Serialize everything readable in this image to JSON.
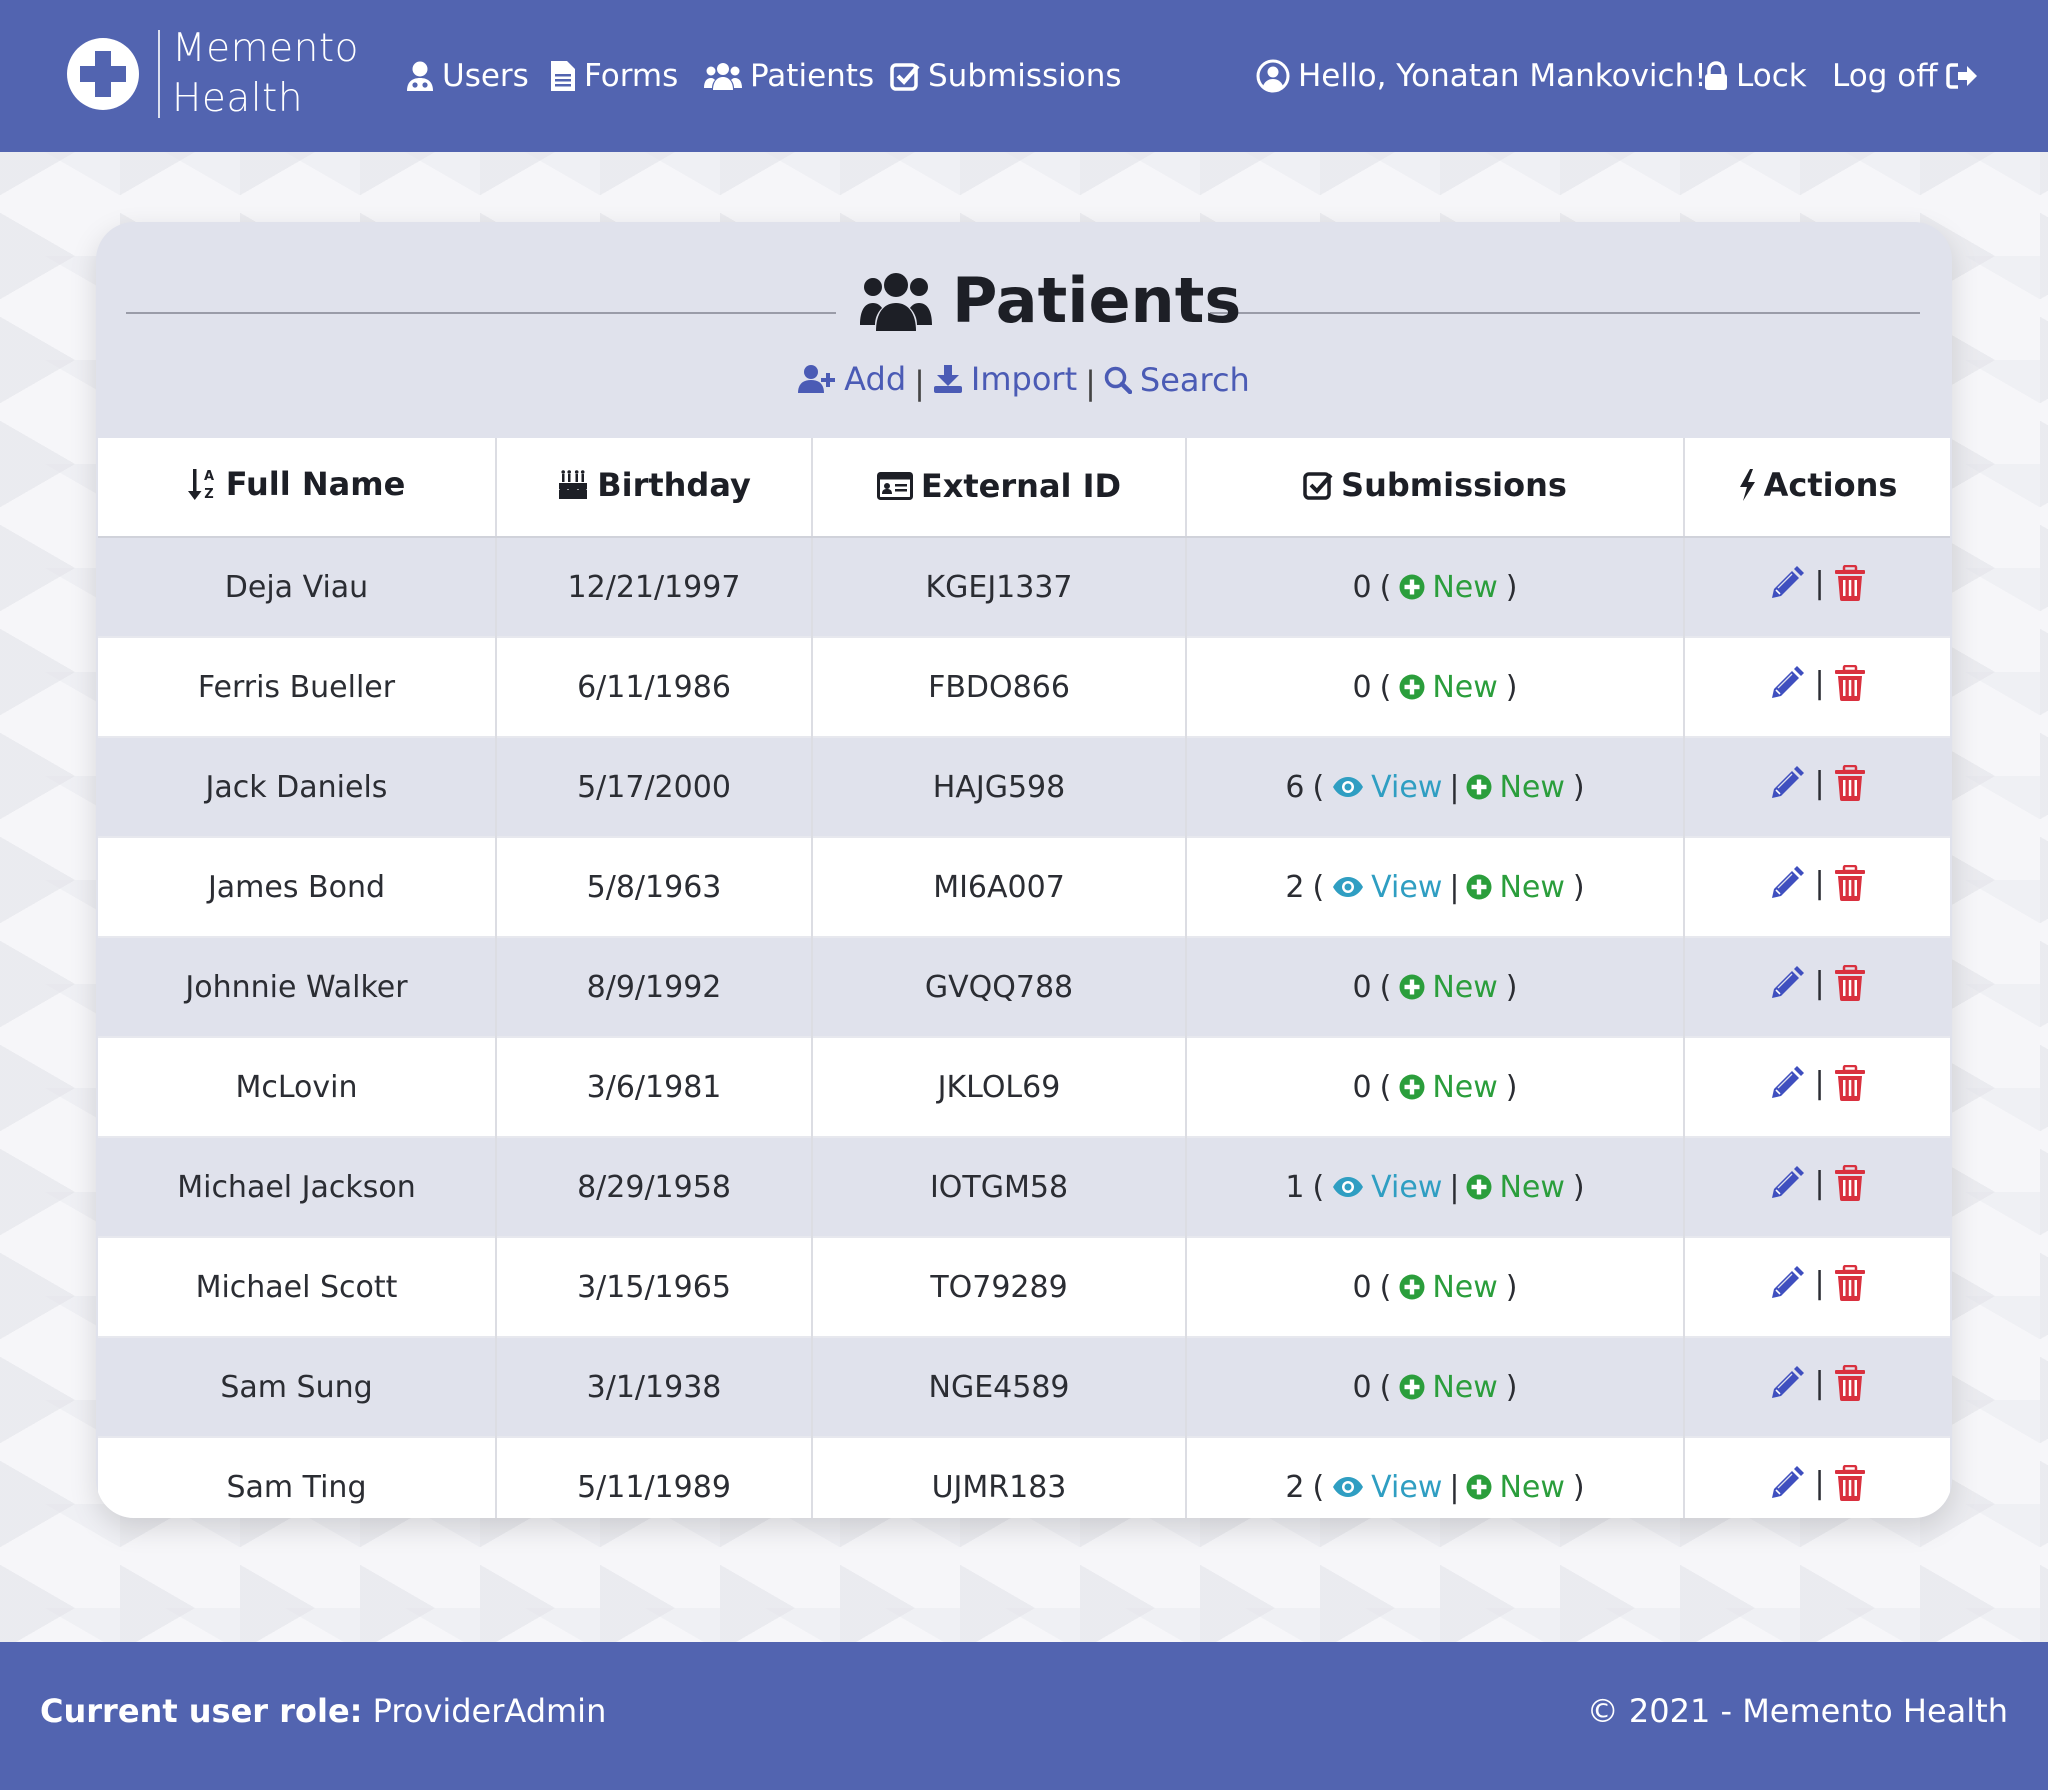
{
  "brand": {
    "line1": "Memento",
    "line2": "Health"
  },
  "nav": {
    "users": "Users",
    "forms": "Forms",
    "patients": "Patients",
    "submissions": "Submissions",
    "greeting": "Hello, Yonatan Mankovich!",
    "lock": "Lock",
    "logoff": "Log off"
  },
  "page": {
    "title": "Patients",
    "actions": {
      "add": "Add",
      "import": "Import",
      "search": "Search"
    }
  },
  "table": {
    "headers": {
      "full_name": "Full Name",
      "birthday": "Birthday",
      "external_id": "External ID",
      "submissions": "Submissions",
      "actions": "Actions"
    },
    "view_label": "View",
    "new_label": "New",
    "rows": [
      {
        "name": "Deja Viau",
        "birthday": "12/21/1997",
        "external_id": "KGEJ1337",
        "submissions": "0"
      },
      {
        "name": "Ferris Bueller",
        "birthday": "6/11/1986",
        "external_id": "FBDO866",
        "submissions": "0"
      },
      {
        "name": "Jack Daniels",
        "birthday": "5/17/2000",
        "external_id": "HAJG598",
        "submissions": "6"
      },
      {
        "name": "James Bond",
        "birthday": "5/8/1963",
        "external_id": "MI6A007",
        "submissions": "2"
      },
      {
        "name": "Johnnie Walker",
        "birthday": "8/9/1992",
        "external_id": "GVQQ788",
        "submissions": "0"
      },
      {
        "name": "McLovin",
        "birthday": "3/6/1981",
        "external_id": "JKLOL69",
        "submissions": "0"
      },
      {
        "name": "Michael Jackson",
        "birthday": "8/29/1958",
        "external_id": "IOTGM58",
        "submissions": "1"
      },
      {
        "name": "Michael Scott",
        "birthday": "3/15/1965",
        "external_id": "TO79289",
        "submissions": "0"
      },
      {
        "name": "Sam Sung",
        "birthday": "3/1/1938",
        "external_id": "NGE4589",
        "submissions": "0"
      },
      {
        "name": "Sam Ting",
        "birthday": "5/11/1989",
        "external_id": "UJMR183",
        "submissions": "2"
      }
    ]
  },
  "footer": {
    "role_label": "Current user role:",
    "role_value": "ProviderAdmin",
    "copyright": "© 2021 - Memento Health"
  },
  "colors": {
    "navbar": "#5264b0",
    "card": "#e0e2ec",
    "link": "#4b5bb5",
    "new": "#2b9e3c",
    "view": "#2f9ec2",
    "edit": "#3f4fbf",
    "delete": "#d9303e"
  }
}
